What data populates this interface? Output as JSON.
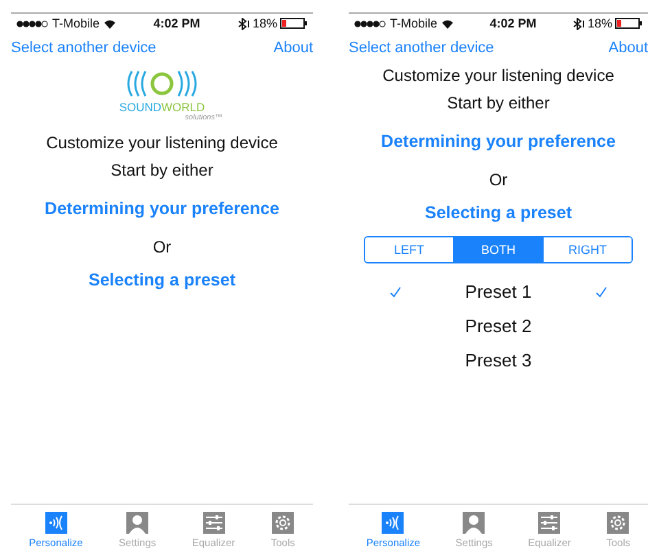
{
  "screens": [
    {
      "status_bar": {
        "carrier": "T-Mobile",
        "time": "4:02 PM",
        "battery": "18%"
      },
      "nav": {
        "left": "Select another device",
        "right": "About"
      },
      "logo": {
        "word_1": "SOUND",
        "word_2": "WORLD",
        "tagline": "solutions™"
      },
      "heading": "Customize your listening device",
      "subheading": "Start by either",
      "option_1": "Determining your preference",
      "separator": "Or",
      "option_2": "Selecting a preset",
      "tabs": [
        {
          "label": "Personalize",
          "kind": "personalize",
          "selected": true
        },
        {
          "label": "Settings",
          "kind": "settings",
          "selected": false
        },
        {
          "label": "Equalizer",
          "kind": "equalizer",
          "selected": false
        },
        {
          "label": "Tools",
          "kind": "tools",
          "selected": false
        }
      ]
    },
    {
      "status_bar": {
        "carrier": "T-Mobile",
        "time": "4:02 PM",
        "battery": "18%"
      },
      "nav": {
        "left": "Select another device",
        "right": "About"
      },
      "heading": "Customize your listening device",
      "subheading": "Start by either",
      "option_1": "Determining your preference",
      "separator": "Or",
      "option_2": "Selecting a preset",
      "segments": [
        {
          "label": "LEFT",
          "selected": false
        },
        {
          "label": "BOTH",
          "selected": true
        },
        {
          "label": "RIGHT",
          "selected": false
        }
      ],
      "presets": [
        {
          "name": "Preset 1",
          "left_checked": true,
          "right_checked": true
        },
        {
          "name": "Preset 2",
          "left_checked": false,
          "right_checked": false
        },
        {
          "name": "Preset 3",
          "left_checked": false,
          "right_checked": false
        }
      ],
      "tabs": [
        {
          "label": "Personalize",
          "kind": "personalize",
          "selected": true
        },
        {
          "label": "Settings",
          "kind": "settings",
          "selected": false
        },
        {
          "label": "Equalizer",
          "kind": "equalizer",
          "selected": false
        },
        {
          "label": "Tools",
          "kind": "tools",
          "selected": false
        }
      ]
    }
  ]
}
